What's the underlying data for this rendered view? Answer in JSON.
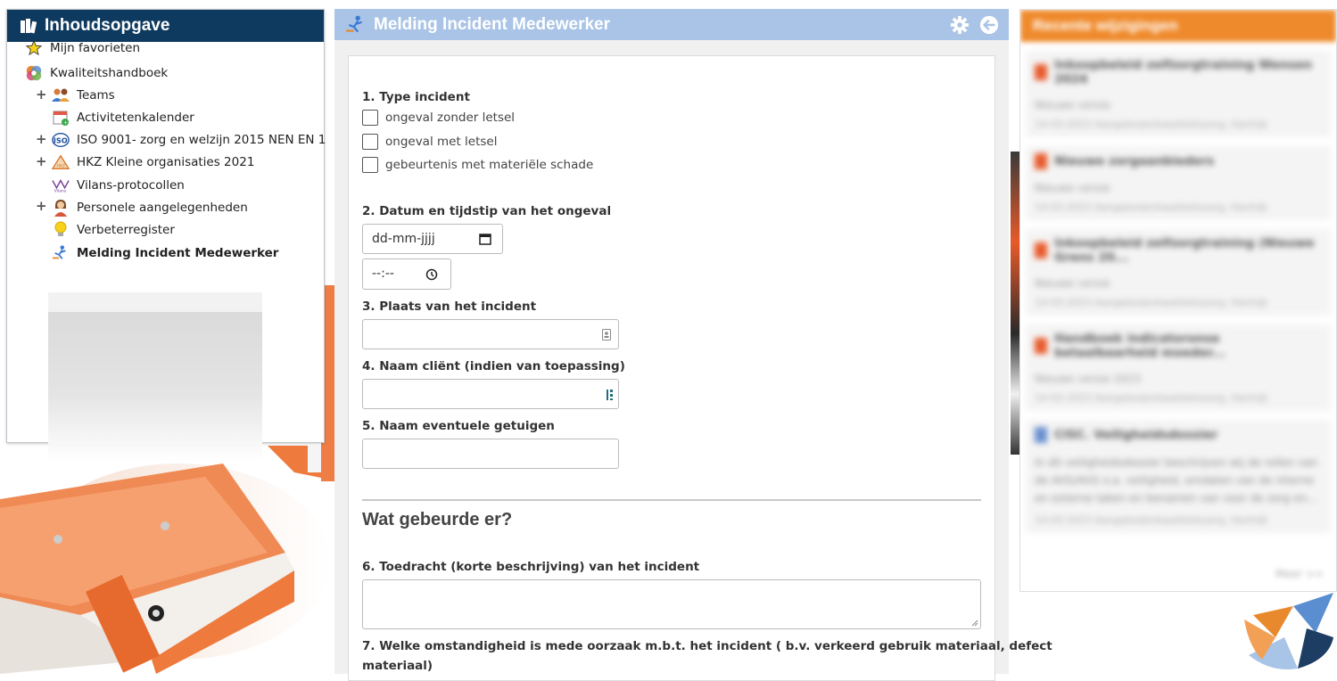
{
  "toc": {
    "title": "Inhoudsopgave",
    "items": [
      {
        "label": "Mijn favorieten"
      },
      {
        "label": "Kwaliteitshandboek"
      },
      {
        "label": "Teams"
      },
      {
        "label": "Activitetenkalender"
      },
      {
        "label": "ISO 9001- zorg en welzijn 2015 NEN EN 1"
      },
      {
        "label": "HKZ Kleine organisaties 2021"
      },
      {
        "label": "Vilans-protocollen"
      },
      {
        "label": "Personele aangelegenheden"
      },
      {
        "label": "Verbeterregister"
      },
      {
        "label": "Melding Incident Medewerker"
      }
    ]
  },
  "form": {
    "title": "Melding Incident Medewerker",
    "q1": {
      "label": "1. Type incident",
      "options": [
        "ongeval zonder letsel",
        "ongeval met letsel",
        "gebeurtenis met materiële schade"
      ]
    },
    "q2": {
      "label": "2. Datum en tijdstip van het ongeval",
      "date_placeholder": "dd-mm-jjjj",
      "time_placeholder": "--:--"
    },
    "q3": {
      "label": "3. Plaats van het incident"
    },
    "q4": {
      "label": "4. Naam cliënt (indien van toepassing)"
    },
    "q5": {
      "label": "5. Naam eventuele getuigen"
    },
    "section_title": "Wat gebeurde er?",
    "q6": {
      "label": "6. Toedracht (korte beschrijving) van het incident"
    },
    "q7": {
      "label_line1": "7. Welke omstandigheid is mede oorzaak m.b.t. het incident ( b.v. verkeerd gebruik materiaal, defect",
      "label_line2": "materiaal)"
    }
  },
  "recent": {
    "title": "Recente wijzigingen",
    "items": [
      {
        "title": "Inkoopbeleid zelfzorgtraining Wensen 2024",
        "sub": "Nieuwe versie",
        "date": "14-03-2023 Aangebodenkwaliteitszorg, Hanhijk",
        "doc": "pdf"
      },
      {
        "title": "Nieuwe zorgaanbieders",
        "sub": "Nieuwe versie",
        "date": "14-03-2023 Aangebodenkwaliteitszorg, Hanhijk",
        "doc": "pdf"
      },
      {
        "title": "Inkoopbeleid zelfzorgtraining (Nieuwe Grens 20...",
        "sub": "Nieuwe versie",
        "date": "14-03-2023 Aangebodenkwaliteitszorg, Hanhijk",
        "doc": "pdf"
      },
      {
        "title": "Handboek indicatoronse betaalbaarheid moeder...",
        "sub": "Nieuwe versie 2023",
        "date": "14-03-2023 Aangebodenkwaliteitszorg, Hanhijk",
        "doc": "pdf"
      },
      {
        "title": "CISC. Veiligheidsdossier",
        "sub": "In dit veiligheidsdossier beschrijven wij de rollen van de AVG/AVG o.a. veiligheid, omdaten van de interne en externe taken en benamen van voor de zorg en...",
        "date": "14-03-2023 Aangebodenkwaliteitszorg, Hanhijk",
        "doc": "word"
      }
    ],
    "more": "Meer >>"
  },
  "colors": {
    "toc_header": "#0f3a5f",
    "form_header": "#a9c4e6",
    "recent_header": "#ef8a2c"
  }
}
